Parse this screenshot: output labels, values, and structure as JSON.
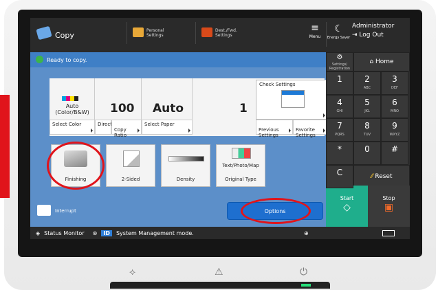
{
  "topbar": {
    "app_title": "Copy",
    "personal_settings": "Personal\nSettings",
    "dest_settings": "Dest./Fwd.\nSettings",
    "menu_label": "Menu",
    "energy_label": "Energy Saver",
    "user_name": "Administrator",
    "logout_label": "Log Out"
  },
  "status": {
    "text": "Ready to copy."
  },
  "settings_panel": {
    "color_mode": "Auto\n(Color/B&W)",
    "ratio_value": "100",
    "ratio_unit": "%",
    "paper_value": "Auto",
    "copies_value": "1",
    "check_settings": "Check Settings",
    "buttons": {
      "select_color": "Select Color",
      "direct": "Direct",
      "copy_ratio": "Copy\nRatio",
      "select_paper": "Select Paper",
      "previous_settings": "Previous\nSettings",
      "favorite_settings": "Favorite\nSettings"
    }
  },
  "functions": [
    {
      "label": "Finishing"
    },
    {
      "label": "2-Sided"
    },
    {
      "label": "Density"
    },
    {
      "label": "Original Type",
      "sublabel": "Text/Photo/Map"
    }
  ],
  "interrupt_label": "Interrupt",
  "options_label": "Options",
  "bottom": {
    "status_monitor": "Status Monitor",
    "message": "System Management mode."
  },
  "side": {
    "settings_label": "Settings/\nRegistration",
    "home_label": "Home",
    "reset_label": "Reset",
    "start_label": "Start",
    "stop_label": "Stop"
  },
  "keypad": [
    {
      "k": "1",
      "s": ""
    },
    {
      "k": "2",
      "s": "ABC"
    },
    {
      "k": "3",
      "s": "DEF"
    },
    {
      "k": "4",
      "s": "GHI"
    },
    {
      "k": "5",
      "s": "JKL"
    },
    {
      "k": "6",
      "s": "MNO"
    },
    {
      "k": "7",
      "s": "PQRS"
    },
    {
      "k": "8",
      "s": "TUV"
    },
    {
      "k": "9",
      "s": "WXYZ"
    },
    {
      "k": "*",
      "s": ""
    },
    {
      "k": "0",
      "s": ""
    },
    {
      "k": "#",
      "s": ""
    },
    {
      "k": "C",
      "s": ""
    }
  ]
}
